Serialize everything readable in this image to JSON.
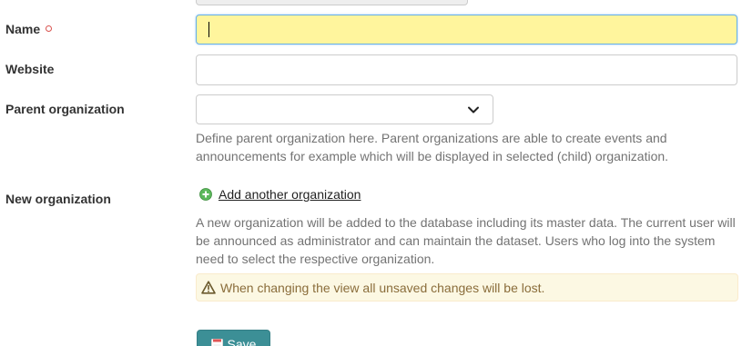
{
  "form": {
    "name": {
      "label": "Name",
      "value": "",
      "required": true
    },
    "website": {
      "label": "Website",
      "value": ""
    },
    "parent_organization": {
      "label": "Parent organization",
      "selected": "",
      "help": "Define parent organization here. Parent organizations are able to create events and announcements for example which will be displayed in selected (child) organization."
    },
    "new_organization": {
      "label": "New organization",
      "link_text": "Add another organization",
      "help": "A new organization will be added to the database including its master data. The current user will be announced as administrator and can maintain the dataset. Users who log into the system need to select the respective organization."
    },
    "alert": {
      "text": "When changing the view all unsaved changes will be lost."
    },
    "save_label": "Save"
  },
  "icons": {
    "required": "required-dot-icon",
    "select": "chevron-down-icon",
    "add": "plus-circle-icon",
    "alert": "warning-triangle-icon",
    "save": "disk-icon"
  },
  "colors": {
    "focused_input_bg": "#fff59d",
    "save_button_bg": "#3c8f96",
    "alert_bg": "#fcf8e3",
    "alert_text": "#8a6d3b",
    "add_icon": "#5cb85c",
    "required_dot": "#d9534f"
  }
}
